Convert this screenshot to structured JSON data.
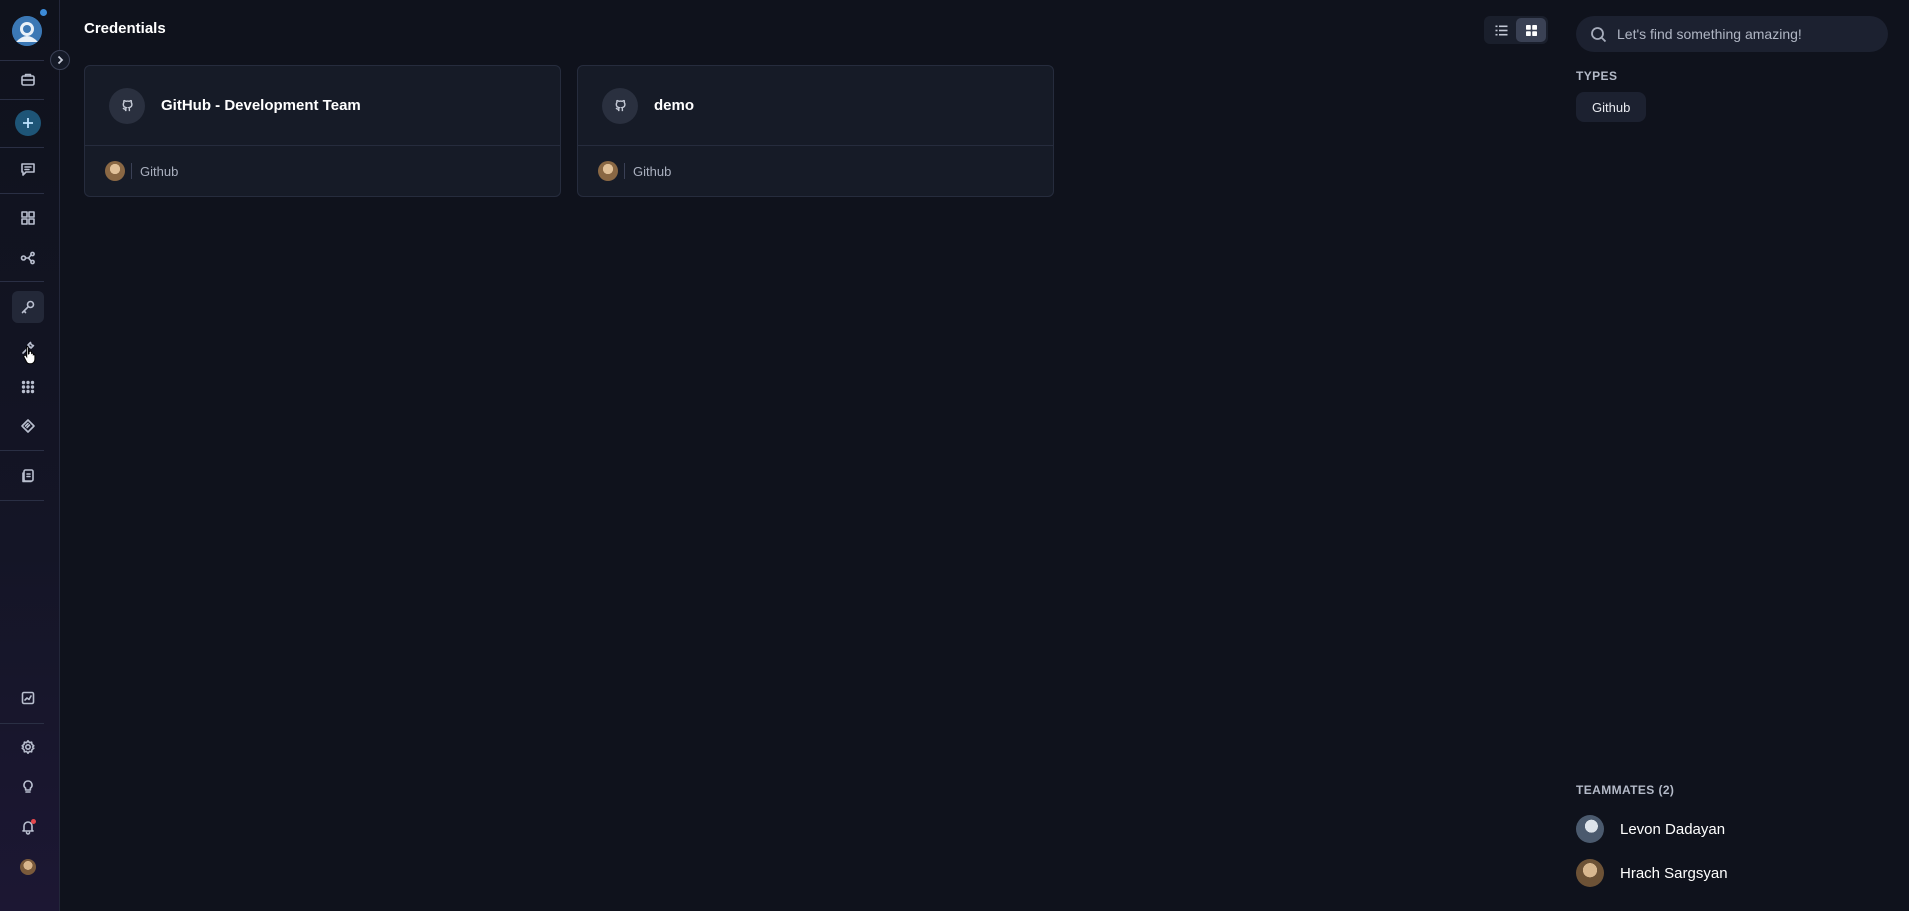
{
  "page": {
    "title": "Credentials"
  },
  "view_toggle": {
    "options": [
      "list-view",
      "grid-view"
    ],
    "selected": "grid-view"
  },
  "credentials": [
    {
      "title": "GitHub - Development Team",
      "type": "Github",
      "icon": "github-icon"
    },
    {
      "title": "demo",
      "type": "Github",
      "icon": "github-icon"
    }
  ],
  "search": {
    "placeholder": "Let's find something amazing!",
    "value": ""
  },
  "filters": {
    "types_label": "TYPES",
    "types": [
      "Github"
    ]
  },
  "teammates": {
    "label": "TEAMMATES (2)",
    "items": [
      {
        "name": "Levon Dadayan"
      },
      {
        "name": "Hrach Sargsyan"
      }
    ]
  },
  "sidebar": {
    "icons": [
      "logo",
      "expand-chevron-icon",
      "briefcase-icon",
      "add-icon",
      "chat-icon",
      "apps-grid-icon",
      "flow-icon",
      "key-icon",
      "tools-icon",
      "dots-grid-icon",
      "tag-icon",
      "documents-icon",
      "report-icon",
      "settings-icon",
      "bulb-icon",
      "bell-icon",
      "avatar"
    ],
    "active": "key-icon"
  },
  "colors": {
    "background": "#0f121c",
    "card": "#161b27",
    "accent": "#3b78b5",
    "notification": "#e5484d"
  }
}
